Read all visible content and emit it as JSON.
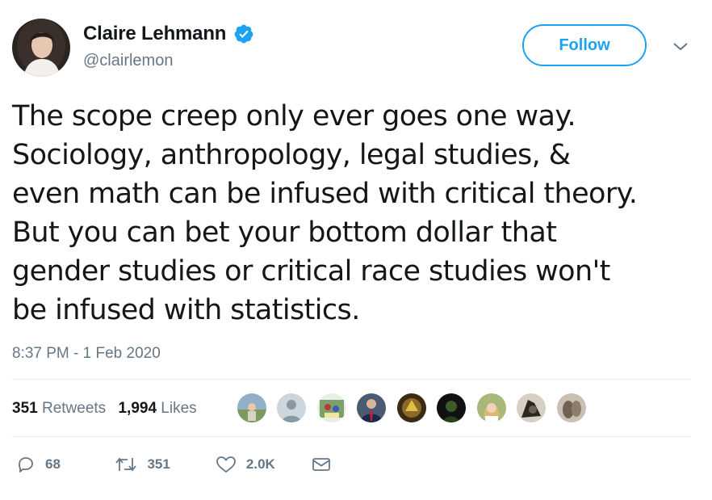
{
  "author": {
    "display_name": "Claire Lehmann",
    "handle": "@clairlemon",
    "verified": true
  },
  "header": {
    "follow_label": "Follow"
  },
  "tweet": {
    "text": "The scope creep only ever goes one way.\nSociology, anthropology, legal studies, &\neven math can be infused with critical theory.\nBut you can bet your bottom dollar that\ngender studies or critical race studies won't\nbe infused with statistics.",
    "timestamp": "8:37 PM - 1 Feb 2020"
  },
  "stats": {
    "retweets_count": "351",
    "retweets_label": "Retweets",
    "likes_count": "1,994",
    "likes_label": "Likes"
  },
  "actions": {
    "reply_count": "68",
    "retweet_count": "351",
    "like_count": "2.0K"
  },
  "colors": {
    "accent": "#1da1f2",
    "secondary_text": "#657786",
    "divider": "#e6ecf0"
  },
  "icons": {
    "verified": "verified-badge-icon",
    "caret": "chevron-down-icon",
    "reply": "reply-icon",
    "retweet": "retweet-icon",
    "like": "heart-icon",
    "message": "envelope-icon"
  }
}
